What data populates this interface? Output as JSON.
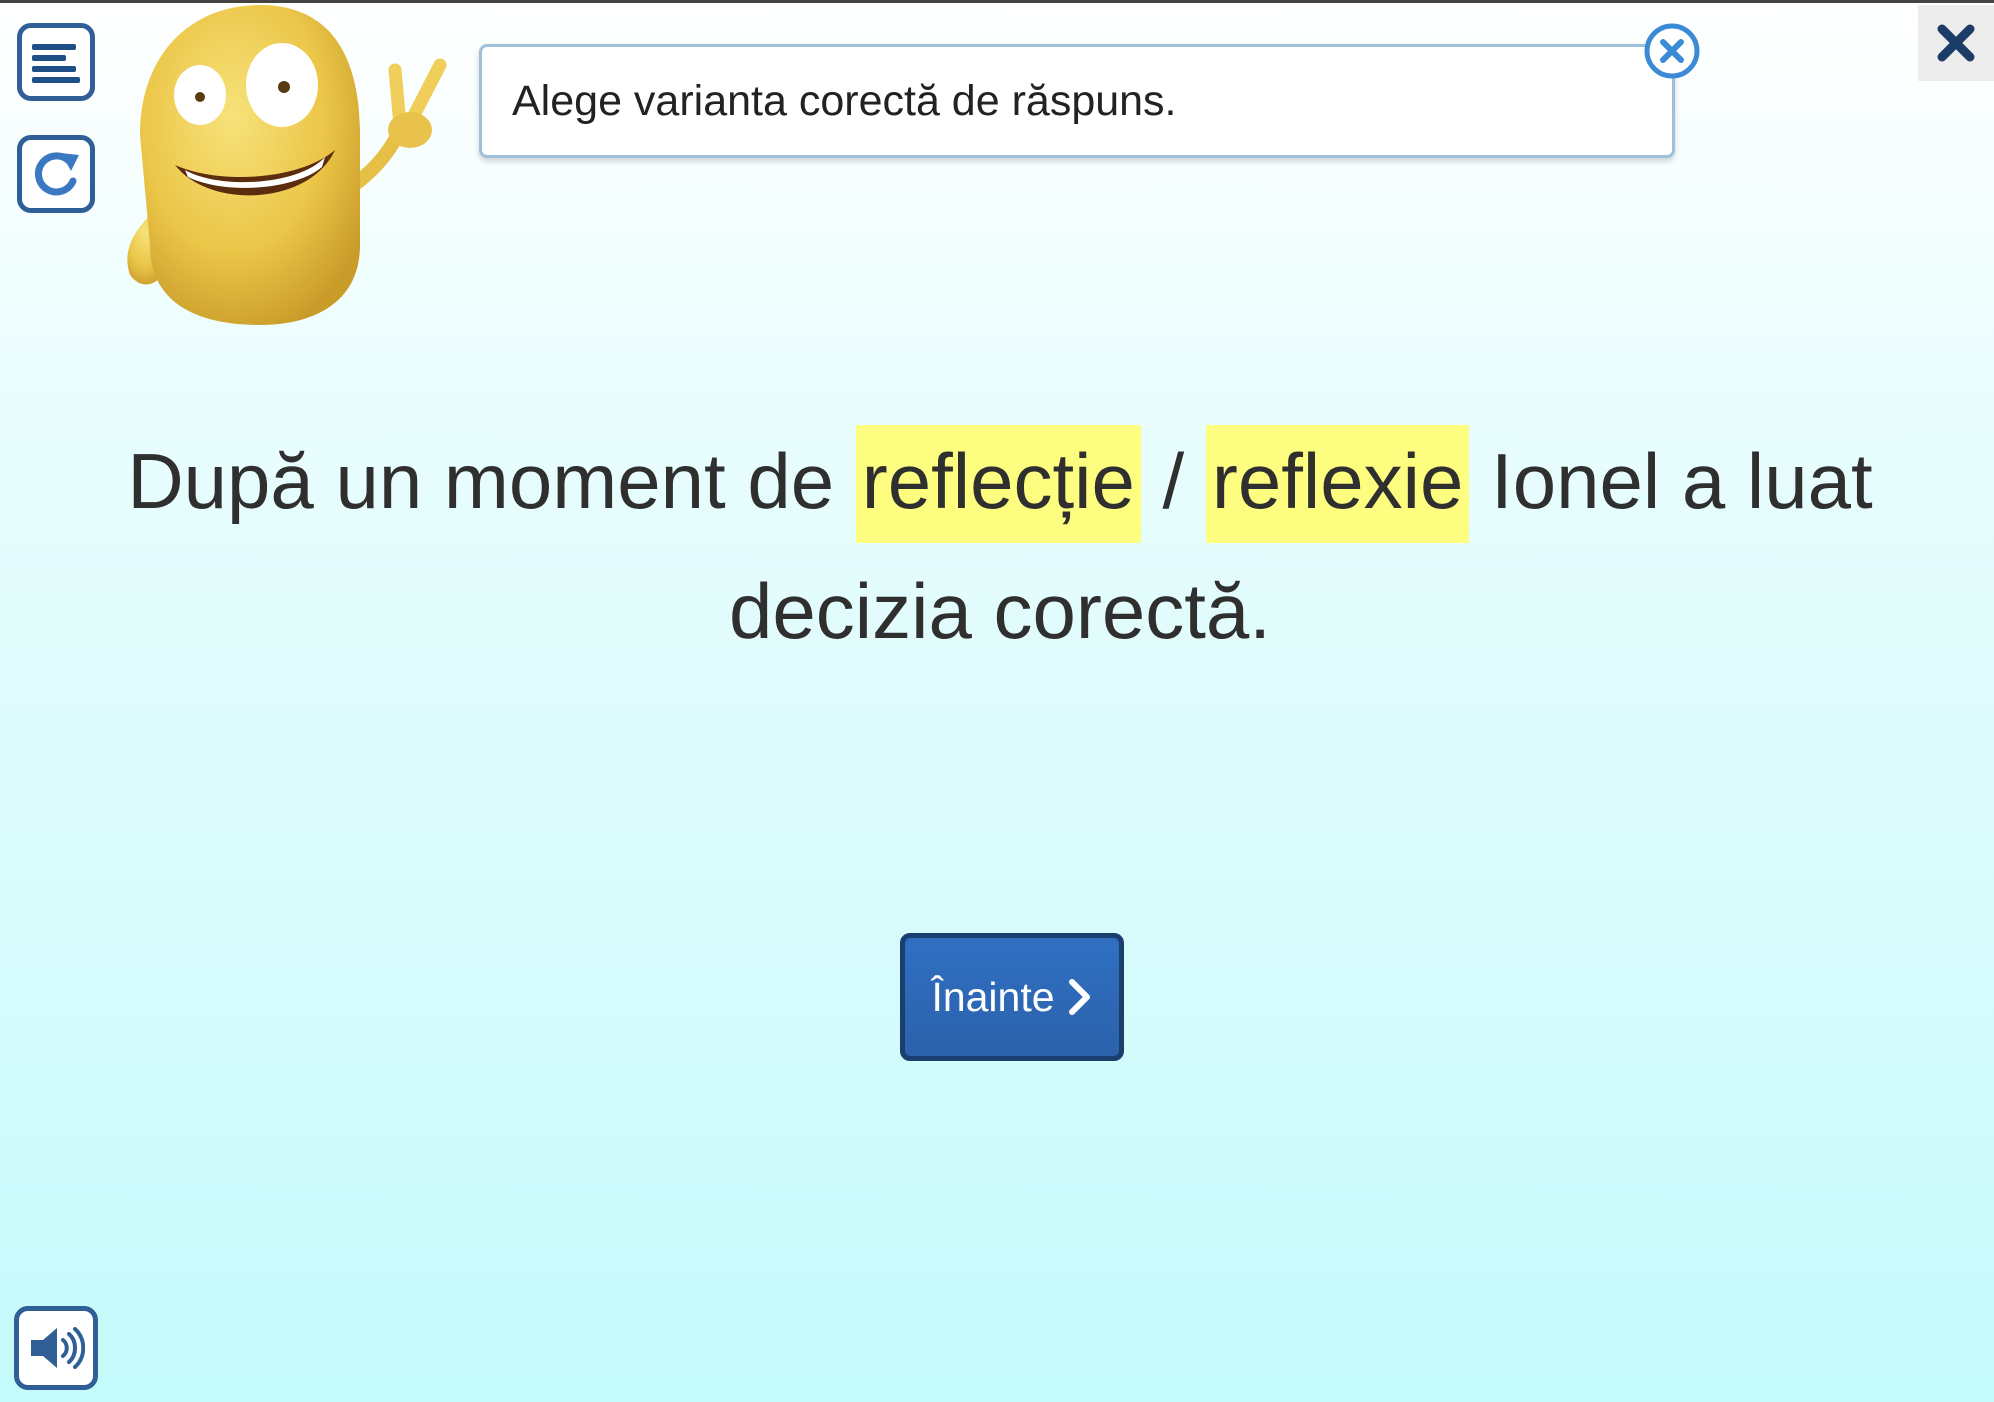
{
  "instruction": {
    "text": "Alege varianta corectă de răspuns."
  },
  "sentence": {
    "before": "După un moment de ",
    "choice_1": "reflecție",
    "separator": " / ",
    "choice_2": "reflexie",
    "after": " Ionel a luat decizia corectă."
  },
  "next_button": {
    "label": "Înainte"
  },
  "colors": {
    "highlight": "#fdfd7f",
    "button": "#2c62ab",
    "frame": "#2f5f96"
  },
  "icons": {
    "menu": "menu-lines-icon",
    "reload": "reload-icon",
    "sound": "speaker-icon",
    "close": "close-icon",
    "tooltip_close": "circle-close-icon",
    "next": "chevron-right-icon"
  }
}
